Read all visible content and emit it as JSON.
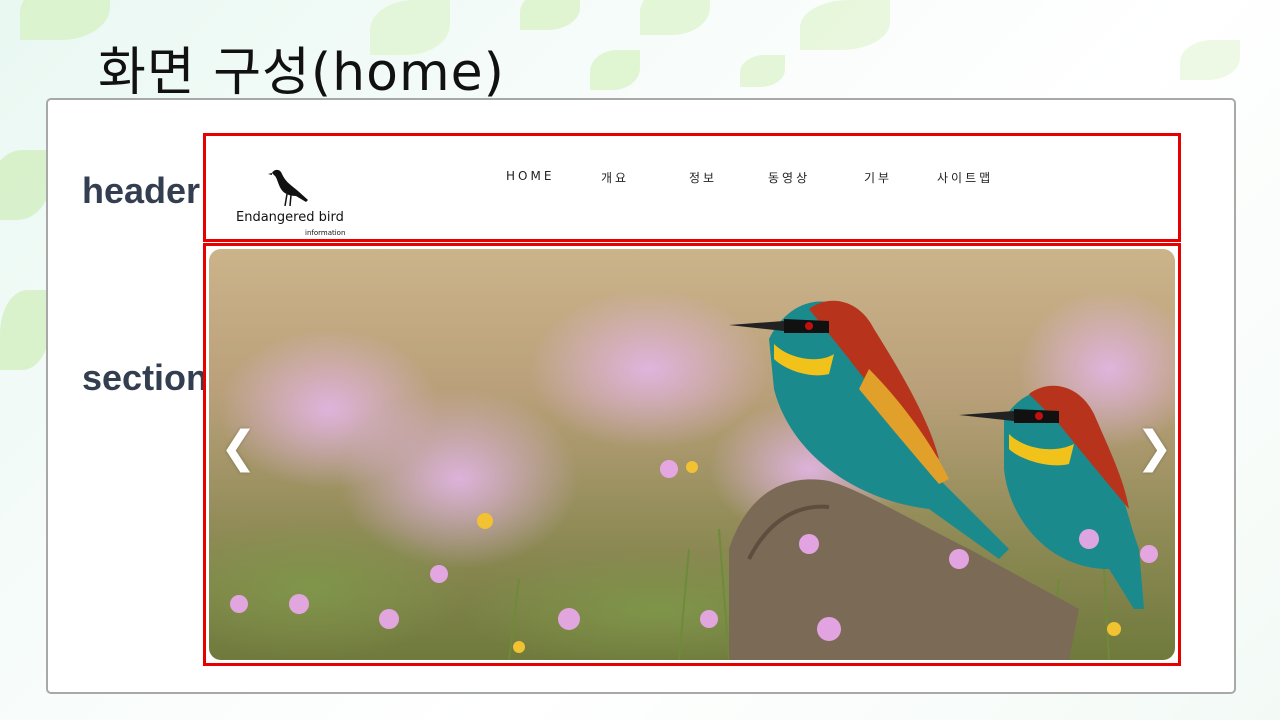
{
  "slide": {
    "title": "화면 구성(home)"
  },
  "labels": {
    "header": "header",
    "section": "section"
  },
  "site_header": {
    "logo_name": "Endangered bird",
    "logo_sub": "information",
    "nav": [
      "HOME",
      "개요",
      "정보",
      "동영상",
      "기부",
      "사이트맵"
    ]
  },
  "slider": {
    "prev_arrow": "❮",
    "next_arrow": "❯"
  },
  "colors": {
    "highlight_border": "#e60000",
    "label_text": "#333f50"
  }
}
